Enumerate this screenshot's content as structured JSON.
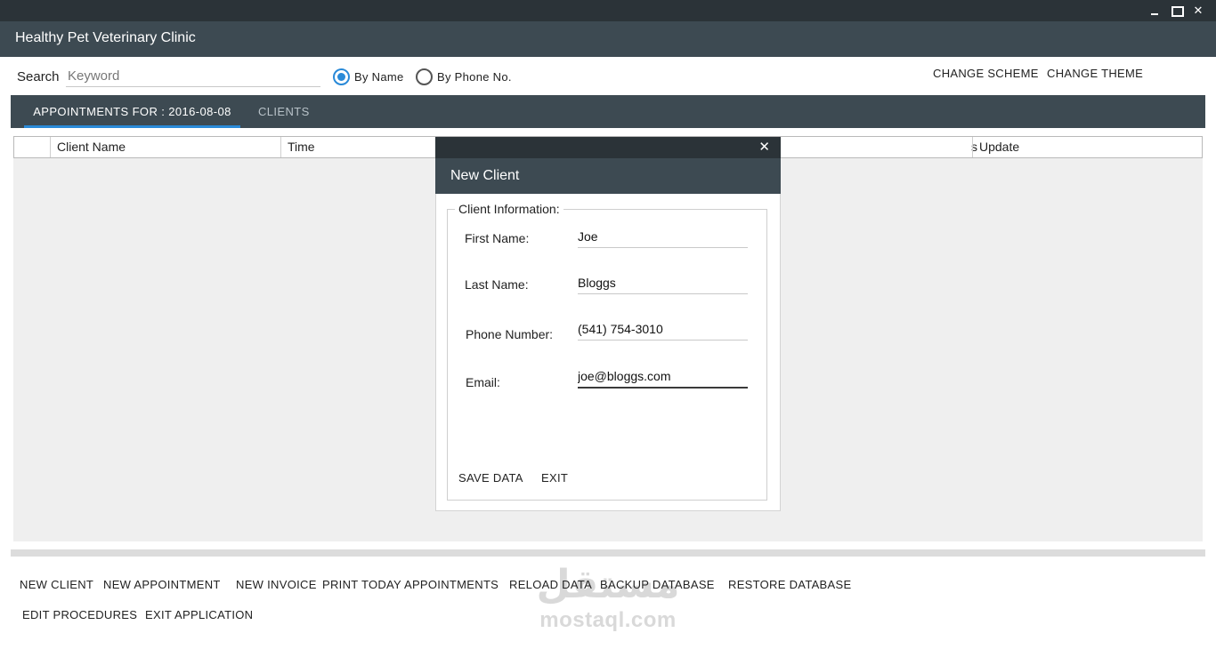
{
  "app": {
    "title": "Healthy Pet Veterinary Clinic"
  },
  "window_controls": {
    "minimize": "–",
    "maximize": "",
    "close": "✕"
  },
  "search": {
    "label": "Search",
    "placeholder": "Keyword",
    "value": ""
  },
  "search_mode": {
    "by_name": "By Name",
    "by_phone": "By Phone No.",
    "selected": "By Name"
  },
  "top_actions": {
    "change_scheme": "CHANGE SCHEME",
    "change_theme": "CHANGE THEME"
  },
  "tabs": [
    {
      "label": "APPOINTMENTS FOR : 2016-08-08",
      "active": true
    },
    {
      "label": "CLIENTS",
      "active": false
    }
  ],
  "grid": {
    "columns": [
      "",
      "Client Name",
      "Time",
      "s",
      "Update"
    ]
  },
  "bottom_actions": {
    "row1": [
      "NEW CLIENT",
      "NEW APPOINTMENT",
      "NEW INVOICE",
      "PRINT TODAY APPOINTMENTS",
      "RELOAD DATA",
      "BACKUP DATABASE",
      "RESTORE DATABASE"
    ],
    "row2": [
      "EDIT PROCEDURES",
      "EXIT APPLICATION"
    ]
  },
  "watermark": {
    "arabic": "مستقل",
    "latin": "mostaql.com"
  },
  "dialog": {
    "close": "✕",
    "title": "New Client",
    "group": "Client Information:",
    "fields": {
      "first_name": {
        "label": "First Name:",
        "value": "Joe"
      },
      "last_name": {
        "label": "Last Name:",
        "value": "Bloggs"
      },
      "phone": {
        "label": "Phone Number:",
        "value": "(541) 754-3010"
      },
      "email": {
        "label": "Email:",
        "value": "joe@bloggs.com"
      }
    },
    "save_label": "SAVE DATA",
    "exit_label": "EXIT"
  },
  "colors": {
    "titlebar": "#2b3338",
    "header": "#3d4a52",
    "accent": "#2a8ad8",
    "grid_bg": "#efefef"
  }
}
